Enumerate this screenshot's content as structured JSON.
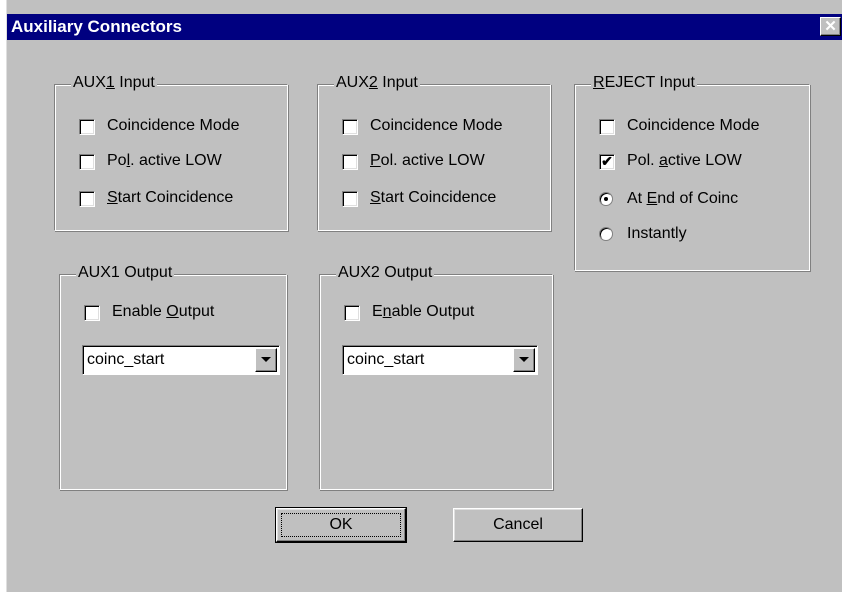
{
  "dialog": {
    "title": "Auxiliary Connectors",
    "close_glyph": "✕"
  },
  "aux1_input": {
    "title_pre": "AUX",
    "title_mn": "1",
    "title_post": " Input",
    "coincidence_mode": {
      "label": "Coincidence Mode",
      "checked": false
    },
    "pol_active_low": {
      "pre": "Po",
      "mn": "l",
      "post": ". active LOW",
      "checked": false
    },
    "start_coincidence": {
      "pre": "",
      "mn": "S",
      "post": "tart Coincidence",
      "checked": false
    }
  },
  "aux2_input": {
    "title_pre": "AUX",
    "title_mn": "2",
    "title_post": " Input",
    "coincidence_mode": {
      "label": "Coincidence Mode",
      "checked": false
    },
    "pol_active_low": {
      "pre": "",
      "mn": "P",
      "post": "ol. active LOW",
      "checked": false
    },
    "start_coincidence": {
      "pre": "",
      "mn": "S",
      "post": "tart Coincidence",
      "checked": false
    }
  },
  "reject_input": {
    "title_pre": "",
    "title_mn": "R",
    "title_post": "EJECT Input",
    "coincidence_mode": {
      "label": "Coincidence Mode",
      "checked": false
    },
    "pol_active_low": {
      "pre": "Pol. ",
      "mn": "a",
      "post": "ctive LOW",
      "checked": true
    },
    "at_end_of_coinc": {
      "pre": "At ",
      "mn": "E",
      "post": "nd of Coinc",
      "selected": true
    },
    "instantly": {
      "label": "Instantly",
      "selected": false
    }
  },
  "aux1_output": {
    "title": "AUX1 Output",
    "enable_output": {
      "pre": "Enable ",
      "mn": "O",
      "post": "utput",
      "checked": false
    },
    "selected_value": "coinc_start"
  },
  "aux2_output": {
    "title": "AUX2 Output",
    "enable_output": {
      "pre": "E",
      "mn": "n",
      "post": "able Output",
      "checked": false
    },
    "selected_value": "coinc_start"
  },
  "buttons": {
    "ok": "OK",
    "cancel": "Cancel"
  },
  "glyphs": {
    "check": "✔"
  },
  "icons": {
    "close": "close-icon",
    "dropdown": "chevron-down-icon",
    "check": "checkmark-icon"
  },
  "colors": {
    "titlebar": "#000080",
    "face": "#c0c0c0"
  }
}
